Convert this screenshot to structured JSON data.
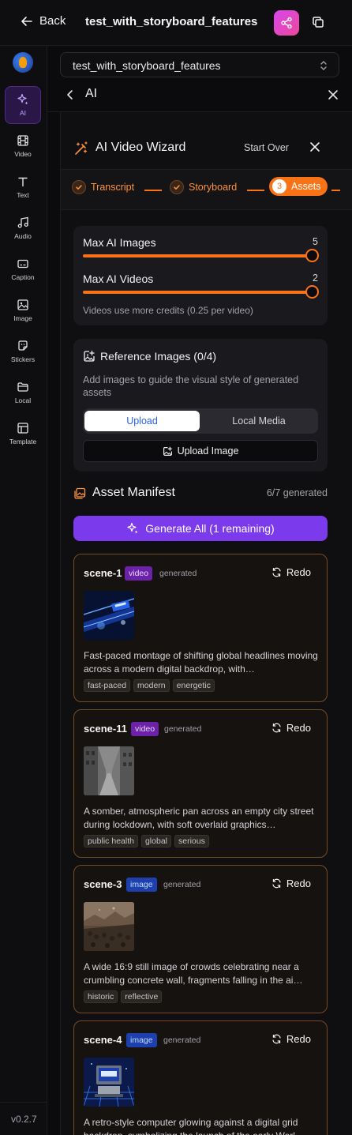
{
  "topbar": {
    "back_label": "Back",
    "project_title": "test_with_storyboard_features"
  },
  "sidebar": {
    "items": [
      {
        "label": "AI",
        "icon": "sparkles-icon"
      },
      {
        "label": "Video",
        "icon": "film-icon"
      },
      {
        "label": "Text",
        "icon": "text-icon"
      },
      {
        "label": "Audio",
        "icon": "music-icon"
      },
      {
        "label": "Caption",
        "icon": "caption-icon"
      },
      {
        "label": "Image",
        "icon": "image-icon"
      },
      {
        "label": "Stickers",
        "icon": "sticker-icon"
      },
      {
        "label": "Local",
        "icon": "folder-icon"
      },
      {
        "label": "Template",
        "icon": "template-icon"
      }
    ],
    "version": "v0.2.7"
  },
  "project_select": {
    "value": "test_with_storyboard_features"
  },
  "ai_panel": {
    "title": "AI"
  },
  "wizard": {
    "title": "AI Video Wizard",
    "start_over": "Start Over",
    "steps": [
      {
        "label": "Transcript",
        "state": "done"
      },
      {
        "label": "Storyboard",
        "state": "done"
      },
      {
        "label": "Assets",
        "number": "3",
        "state": "active"
      }
    ]
  },
  "limits": {
    "max_images_label": "Max AI Images",
    "max_images_value": "5",
    "max_videos_label": "Max AI Videos",
    "max_videos_value": "2",
    "note": "Videos use more credits (0.25 per video)"
  },
  "reference": {
    "title": "Reference Images (0/4)",
    "description": "Add images to guide the visual style of generated assets",
    "tab_upload": "Upload",
    "tab_local": "Local Media",
    "upload_button": "Upload Image"
  },
  "manifest": {
    "title": "Asset Manifest",
    "count": "6/7 generated",
    "generate_all": "Generate All (1 remaining)",
    "redo_label": "Redo",
    "assets": [
      {
        "name": "scene-1",
        "type": "video",
        "status": "generated",
        "description": "Fast-paced montage of shifting global headlines moving across a modern digital backdrop, with…",
        "tags": [
          "fast-paced",
          "modern",
          "energetic"
        ]
      },
      {
        "name": "scene-11",
        "type": "video",
        "status": "generated",
        "description": "A somber, atmospheric pan across an empty city street during lockdown, with soft overlaid graphics…",
        "tags": [
          "public health",
          "global",
          "serious"
        ]
      },
      {
        "name": "scene-3",
        "type": "image",
        "status": "generated",
        "description": "A wide 16:9 still image of crowds celebrating near a crumbling concrete wall, fragments falling in the ai…",
        "tags": [
          "historic",
          "reflective"
        ]
      },
      {
        "name": "scene-4",
        "type": "image",
        "status": "generated",
        "description": "A retro-style computer glowing against a digital grid backdrop, symbolizing the launch of the early Worl…",
        "tags": []
      }
    ]
  },
  "colors": {
    "accent_orange": "#f97316",
    "accent_purple": "#7c3aed",
    "share_pink": "#ec4899"
  }
}
